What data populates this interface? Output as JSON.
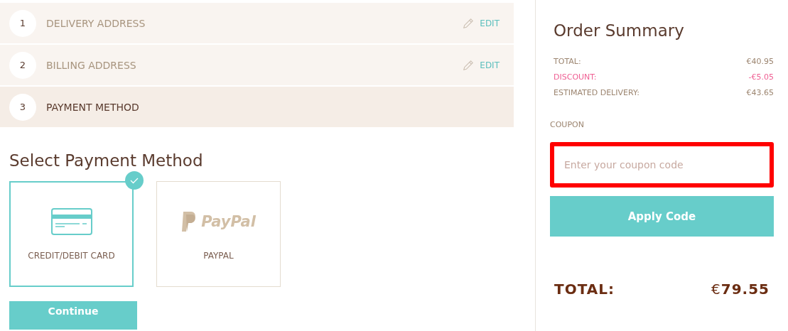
{
  "steps": [
    {
      "number": "1",
      "label": "DELIVERY ADDRESS",
      "selected": false,
      "edit": "EDIT"
    },
    {
      "number": "2",
      "label": "BILLING ADDRESS",
      "selected": false,
      "edit": "EDIT"
    },
    {
      "number": "3",
      "label": "PAYMENT METHOD",
      "selected": true
    }
  ],
  "payment": {
    "title": "Select Payment Method",
    "methods": [
      {
        "kind": "card",
        "label": "CREDIT/DEBIT CARD",
        "selected": true
      },
      {
        "kind": "paypal",
        "label": "PAYPAL",
        "logo_text": "PayPal",
        "selected": false
      }
    ],
    "continue": "Continue"
  },
  "summary": {
    "title": "Order Summary",
    "lines": [
      {
        "label": "TOTAL:",
        "value": "€40.95",
        "kind": "normal"
      },
      {
        "label": "DISCOUNT:",
        "value": "-€5.05",
        "kind": "discount"
      },
      {
        "label": "ESTIMATED DELIVERY:",
        "value": "€43.65",
        "kind": "normal"
      }
    ],
    "coupon": {
      "label": "COUPON",
      "placeholder": "Enter your coupon code",
      "highlighted": true
    },
    "apply": "Apply Code",
    "total": {
      "label": "TOTAL:",
      "currency": "€",
      "amount": "79.55"
    }
  }
}
